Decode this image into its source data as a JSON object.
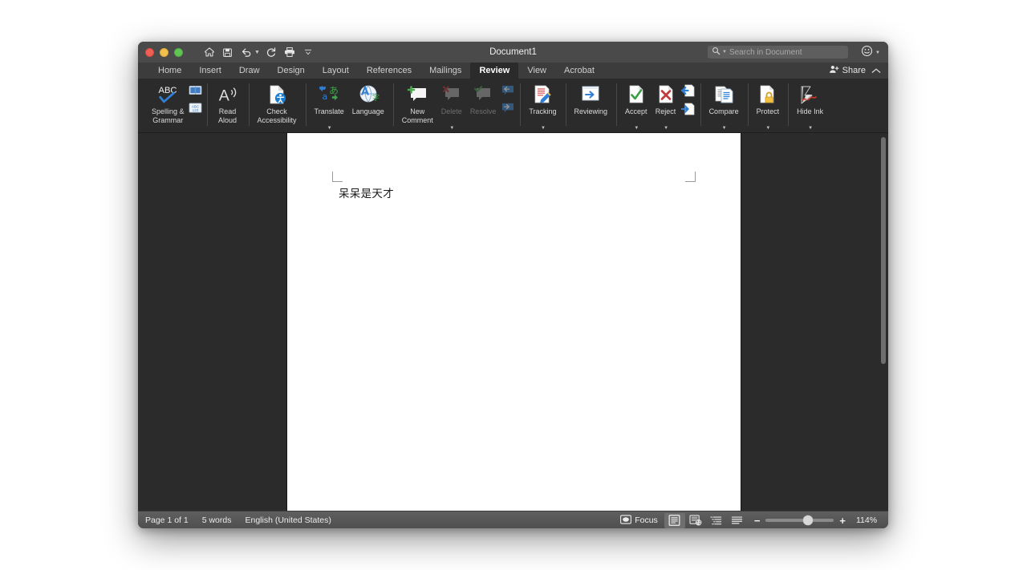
{
  "window": {
    "title": "Document1",
    "traffic_lights": [
      {
        "name": "close",
        "color": "#ef5f56"
      },
      {
        "name": "minimize",
        "color": "#f0bf4c"
      },
      {
        "name": "zoom",
        "color": "#61c454"
      }
    ],
    "quick_access": [
      {
        "name": "home-icon",
        "label": "Home"
      },
      {
        "name": "save-icon",
        "label": "Save"
      },
      {
        "name": "undo-icon",
        "label": "Undo"
      },
      {
        "name": "redo-icon",
        "label": "Redo"
      },
      {
        "name": "print-icon",
        "label": "Print"
      },
      {
        "name": "customize-toolbar-icon",
        "label": "Customize"
      }
    ]
  },
  "search": {
    "placeholder": "Search in Document",
    "value": ""
  },
  "tabs": [
    {
      "label": "Home",
      "active": false
    },
    {
      "label": "Insert",
      "active": false
    },
    {
      "label": "Draw",
      "active": false
    },
    {
      "label": "Design",
      "active": false
    },
    {
      "label": "Layout",
      "active": false
    },
    {
      "label": "References",
      "active": false
    },
    {
      "label": "Mailings",
      "active": false
    },
    {
      "label": "Review",
      "active": true
    },
    {
      "label": "View",
      "active": false
    },
    {
      "label": "Acrobat",
      "active": false
    }
  ],
  "share": {
    "label": "Share"
  },
  "ribbon": {
    "groups": [
      {
        "name": "proofing",
        "items": [
          {
            "name": "spelling-and-grammar",
            "label": "Spelling &\nGrammar",
            "icon": "abc-check-icon",
            "disabled": false
          },
          {
            "name": "thesaurus",
            "label": "",
            "icon": "thesaurus-book-icon",
            "disabled": false
          },
          {
            "name": "word-count",
            "label": "",
            "icon": "abc-123-icon",
            "disabled": false
          }
        ]
      },
      {
        "name": "speech",
        "items": [
          {
            "name": "read-aloud",
            "label": "Read\nAloud",
            "icon": "read-aloud-icon",
            "disabled": false
          }
        ]
      },
      {
        "name": "accessibility",
        "items": [
          {
            "name": "check-accessibility",
            "label": "Check\nAccessibility",
            "icon": "check-accessibility-icon",
            "disabled": false
          }
        ]
      },
      {
        "name": "language",
        "items": [
          {
            "name": "translate",
            "label": "Translate",
            "icon": "translate-icon",
            "disabled": false,
            "caret": true
          },
          {
            "name": "language",
            "label": "Language",
            "icon": "language-globe-icon",
            "disabled": false
          }
        ]
      },
      {
        "name": "comments",
        "items": [
          {
            "name": "new-comment",
            "label": "New\nComment",
            "icon": "new-comment-icon",
            "disabled": false
          },
          {
            "name": "delete-comment",
            "label": "Delete",
            "icon": "delete-comment-icon",
            "disabled": true,
            "caret": true
          },
          {
            "name": "resolve-comment",
            "label": "Resolve",
            "icon": "resolve-comment-icon",
            "disabled": true
          },
          {
            "name": "previous-comment",
            "label": "",
            "icon": "previous-comment-icon",
            "disabled": true
          },
          {
            "name": "next-comment",
            "label": "",
            "icon": "next-comment-icon",
            "disabled": true
          }
        ]
      },
      {
        "name": "tracking",
        "items": [
          {
            "name": "tracking",
            "label": "Tracking",
            "icon": "track-changes-icon",
            "disabled": false,
            "caret": true
          }
        ]
      },
      {
        "name": "reviewing",
        "items": [
          {
            "name": "reviewing-pane",
            "label": "Reviewing",
            "icon": "reviewing-pane-icon",
            "disabled": false
          }
        ]
      },
      {
        "name": "changes",
        "items": [
          {
            "name": "accept",
            "label": "Accept",
            "icon": "accept-check-icon",
            "disabled": false,
            "caret": true
          },
          {
            "name": "reject",
            "label": "Reject",
            "icon": "reject-x-icon",
            "disabled": false,
            "caret": true
          },
          {
            "name": "previous-change",
            "label": "",
            "icon": "previous-change-icon",
            "disabled": false
          },
          {
            "name": "next-change",
            "label": "",
            "icon": "next-change-icon",
            "disabled": false
          }
        ]
      },
      {
        "name": "compare",
        "items": [
          {
            "name": "compare",
            "label": "Compare",
            "icon": "compare-docs-icon",
            "disabled": false,
            "caret": true
          }
        ]
      },
      {
        "name": "protect",
        "items": [
          {
            "name": "protect",
            "label": "Protect",
            "icon": "protect-lock-icon",
            "disabled": false,
            "caret": true
          }
        ]
      },
      {
        "name": "ink",
        "items": [
          {
            "name": "hide-ink",
            "label": "Hide Ink",
            "icon": "hide-ink-icon",
            "disabled": false,
            "caret": true
          }
        ]
      }
    ]
  },
  "document": {
    "body_text": "呆呆是天才"
  },
  "status": {
    "page_info": "Page 1 of 1",
    "word_count": "5 words",
    "language": "English (United States)",
    "focus_label": "Focus",
    "view_buttons": [
      {
        "name": "print-layout-view",
        "active": true
      },
      {
        "name": "web-layout-view",
        "active": false
      },
      {
        "name": "outline-view",
        "active": false
      },
      {
        "name": "draft-view",
        "active": false
      }
    ],
    "zoom_level": "114%",
    "zoom_minus": "−",
    "zoom_plus": "+"
  }
}
